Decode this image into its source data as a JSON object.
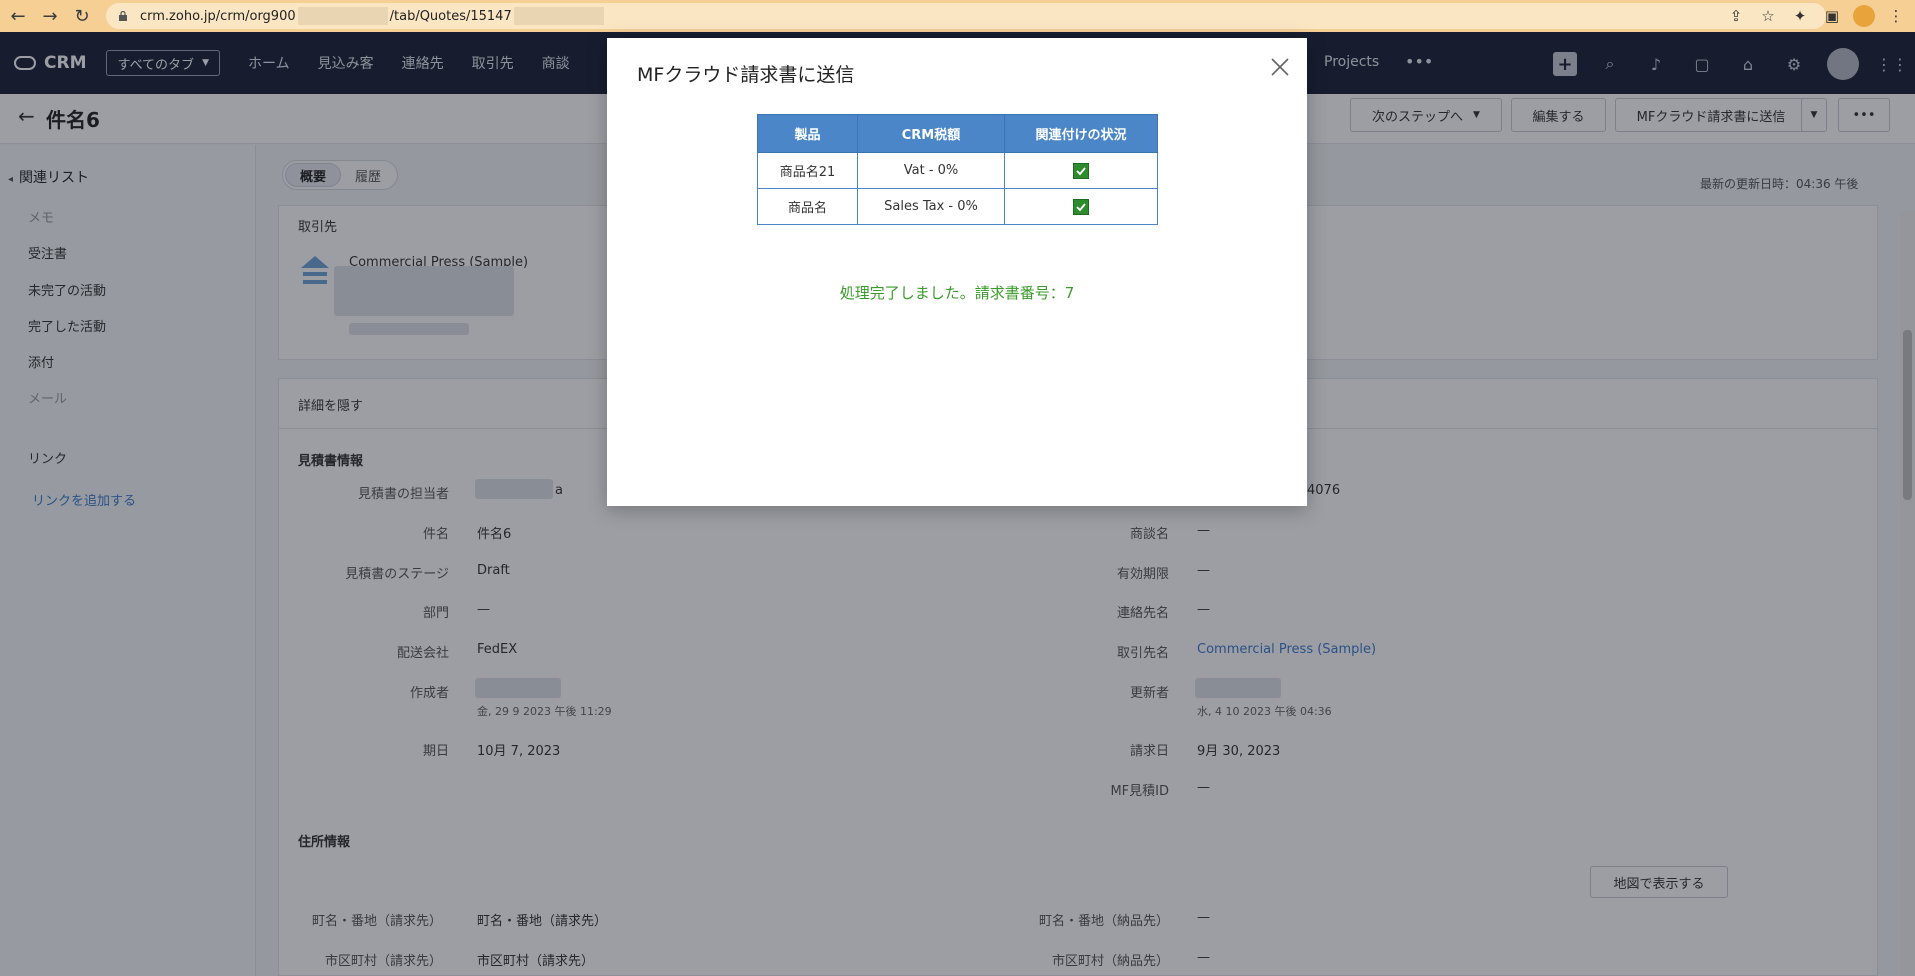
{
  "browser": {
    "url_prefix": "crm.zoho.jp/crm/org900",
    "url_mid": "/tab/Quotes/15147"
  },
  "header": {
    "logo": "CRM",
    "tabs_select": "すべてのタブ",
    "nav": [
      "ホーム",
      "見込み客",
      "連絡先",
      "取引先",
      "商談"
    ],
    "projects": "Projects",
    "more": "•••"
  },
  "record": {
    "title": "件名6",
    "buttons": {
      "next_step": "次のステップへ",
      "edit": "編集する",
      "send_mf": "MFクラウド請求書に送信",
      "more": "•••"
    }
  },
  "sidebar": {
    "heading": "関連リスト",
    "items": [
      "メモ",
      "受注書",
      "未完了の活動",
      "完了した活動",
      "添付",
      "メール"
    ],
    "links_heading": "リンク",
    "add_link": "リンクを追加する"
  },
  "main": {
    "tabs": [
      "概要",
      "履歴"
    ],
    "last_updated": "最新の更新日時：04:36 午後",
    "account_section": "取引先",
    "account_name": "Commercial Press (Sample)",
    "details_toggle": "詳細を隠す",
    "quote_info_title": "見積書情報",
    "fields_left": [
      {
        "label": "見積書の担当者",
        "value": "a"
      },
      {
        "label": "件名",
        "value": "件名6"
      },
      {
        "label": "見積書のステージ",
        "value": "Draft"
      },
      {
        "label": "部門",
        "value": "—"
      },
      {
        "label": "配送会社",
        "value": "FedEX"
      },
      {
        "label": "作成者",
        "value": "金, 29 9 2023 午後 11:29"
      },
      {
        "label": "期日",
        "value": "10月 7, 2023"
      }
    ],
    "fields_right": [
      {
        "label": "",
        "value": "4076"
      },
      {
        "label": "商談名",
        "value": "—"
      },
      {
        "label": "有効期限",
        "value": "—"
      },
      {
        "label": "連絡先名",
        "value": "—"
      },
      {
        "label": "取引先名",
        "value": "Commercial Press (Sample)"
      },
      {
        "label": "更新者",
        "value": "水, 4 10 2023 午後 04:36"
      },
      {
        "label": "請求日",
        "value": "9月 30, 2023"
      },
      {
        "label": "MF見積ID",
        "value": "—"
      }
    ],
    "address_title": "住所情報",
    "map_button": "地図で表示する",
    "address_rows": [
      {
        "label_left": "町名・番地（請求先）",
        "value_left": "町名・番地（請求先）",
        "label_right": "町名・番地（納品先）",
        "value_right": "—"
      },
      {
        "label_left": "市区町村（請求先）",
        "value_left": "市区町村（請求先）",
        "label_right": "市区町村（納品先）",
        "value_right": "—"
      }
    ]
  },
  "modal": {
    "title": "MFクラウド請求書に送信",
    "columns": [
      "製品",
      "CRM税額",
      "関連付けの状況"
    ],
    "rows": [
      {
        "product": "商品名21",
        "tax": "Vat - 0%"
      },
      {
        "product": "商品名",
        "tax": "Sales Tax - 0%"
      }
    ],
    "message": "処理完了しました。請求書番号：7",
    "colors": {
      "header": "#4a86c8",
      "success": "#3a9a2a"
    }
  }
}
